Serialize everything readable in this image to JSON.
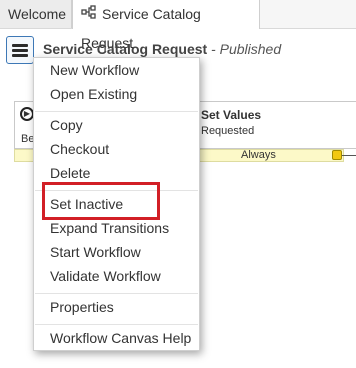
{
  "tabs": [
    {
      "label": "Welcome"
    },
    {
      "label": "Service Catalog Request",
      "icon": "workflow-icon"
    }
  ],
  "header": {
    "menu_icon": "hamburger-icon",
    "title": "Service Catalog Request",
    "status": " - Published"
  },
  "canvas": {
    "begin_label": "Be",
    "set_values_title": "Set Values",
    "set_values_subtitle": "Requested",
    "condition_label": "Always",
    "condition_color": "#fcf9c8"
  },
  "menu": {
    "items": [
      {
        "label": "New Workflow"
      },
      {
        "label": "Open Existing"
      },
      {
        "label": "Copy"
      },
      {
        "label": "Checkout"
      },
      {
        "label": "Delete"
      },
      {
        "label": "Set Inactive"
      },
      {
        "label": "Expand Transitions"
      },
      {
        "label": "Start Workflow"
      },
      {
        "label": "Validate Workflow"
      },
      {
        "label": "Properties"
      },
      {
        "label": "Workflow Canvas Help"
      }
    ],
    "highlight_color": "#d21f26"
  }
}
